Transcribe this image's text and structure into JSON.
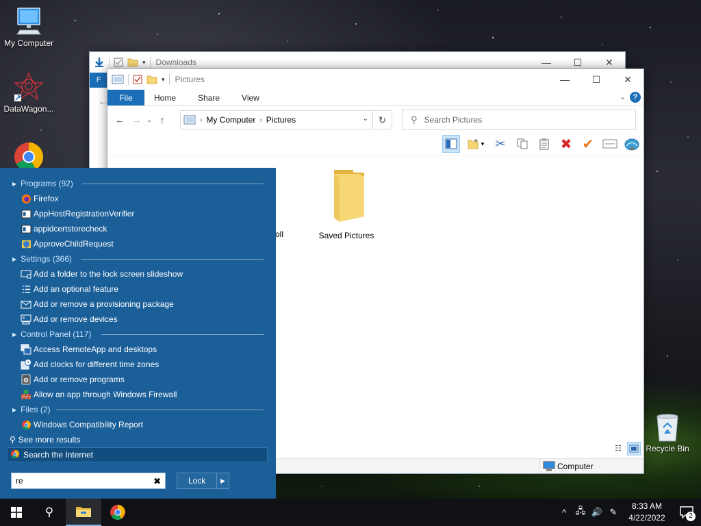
{
  "desktop": {
    "icons": [
      {
        "label": "My Computer",
        "icon": "computer-icon"
      },
      {
        "label": "DataWagon...",
        "icon": "datawagon-shortcut-icon"
      },
      {
        "label": "",
        "icon": "chrome-icon"
      },
      {
        "label": "Recycle Bin",
        "icon": "recycle-bin-icon"
      }
    ]
  },
  "window_back": {
    "title": "Downloads",
    "file_tab": "F"
  },
  "window_front": {
    "title": "Pictures",
    "tabs": {
      "file": "File",
      "home": "Home",
      "share": "Share",
      "view": "View"
    },
    "address": {
      "root": "My Computer",
      "current": "Pictures"
    },
    "search_placeholder": "Search Pictures",
    "folders": [
      {
        "label": "oll",
        "icon": "folder-icon"
      },
      {
        "label": "Saved Pictures",
        "icon": "folder-icon"
      }
    ],
    "status": {
      "location": "Computer"
    },
    "colors": {
      "accent": "#1a6fb8",
      "delete": "#d62b2b",
      "check": "#e7761c"
    }
  },
  "start_menu": {
    "categories": [
      {
        "label": "Programs (92)",
        "items": [
          {
            "label": "Firefox",
            "icon": "firefox-icon"
          },
          {
            "label": "AppHostRegistrationVerifier",
            "icon": "app-window-icon"
          },
          {
            "label": "appidcertstorecheck",
            "icon": "app-window-icon"
          },
          {
            "label": "ApproveChildRequest",
            "icon": "shield-app-icon"
          }
        ]
      },
      {
        "label": "Settings (366)",
        "items": [
          {
            "label": "Add a folder to the lock screen slideshow",
            "icon": "slideshow-icon"
          },
          {
            "label": "Add an optional feature",
            "icon": "feature-list-icon"
          },
          {
            "label": "Add or remove a provisioning package",
            "icon": "package-icon"
          },
          {
            "label": "Add or remove devices",
            "icon": "devices-icon"
          }
        ]
      },
      {
        "label": "Control Panel (117)",
        "items": [
          {
            "label": "Access RemoteApp and desktops",
            "icon": "remote-app-icon"
          },
          {
            "label": "Add clocks for different time zones",
            "icon": "clock-icon"
          },
          {
            "label": "Add or remove programs",
            "icon": "programs-icon"
          },
          {
            "label": "Allow an app through Windows Firewall",
            "icon": "firewall-icon"
          }
        ]
      },
      {
        "label": "Files (2)",
        "items": [
          {
            "label": "Windows Compatibility Report",
            "icon": "chrome-icon"
          }
        ]
      }
    ],
    "see_more": "See more results",
    "search_internet": "Search the Internet",
    "search_value": "re",
    "lock_label": "Lock",
    "colors": {
      "background": "#1b5f99",
      "category_text": "#c7e3ff"
    }
  },
  "taskbar": {
    "time": "8:33 AM",
    "date": "4/22/2022",
    "notification_count": "2"
  }
}
